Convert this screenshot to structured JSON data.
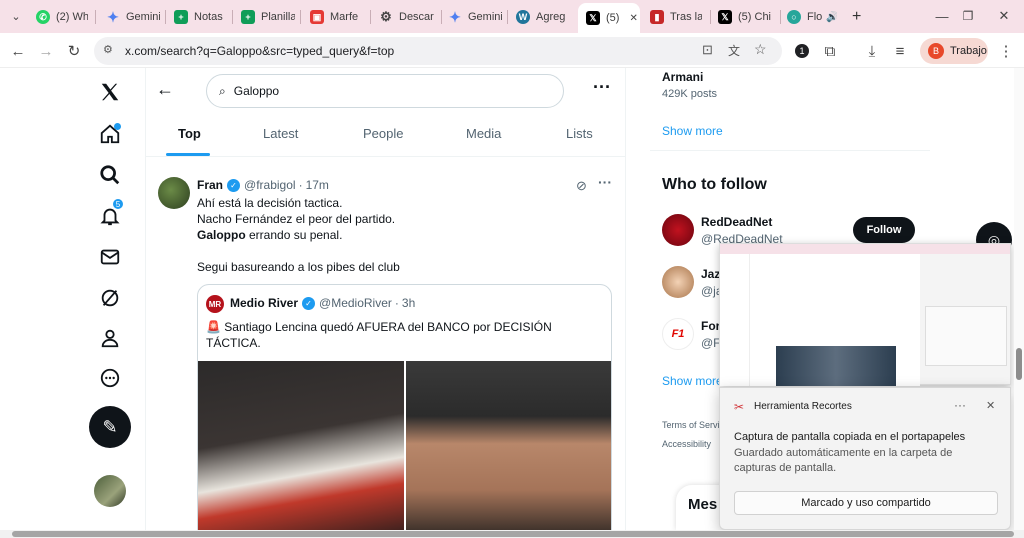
{
  "browser": {
    "tabs": [
      {
        "label": "(2) Wh",
        "fav": "whatsapp-icon",
        "color": "#25d366"
      },
      {
        "label": "Gemini",
        "fav": "gemini-icon",
        "color": "#4f7ff0"
      },
      {
        "label": "Notas",
        "fav": "sheets-icon",
        "color": "#0f9d58"
      },
      {
        "label": "Planilla",
        "fav": "sheets-icon",
        "color": "#0f9d58"
      },
      {
        "label": "Marfe",
        "fav": "gift-icon",
        "color": "#e53935"
      },
      {
        "label": "Descar",
        "fav": "openai-icon",
        "color": "#444444"
      },
      {
        "label": "Gemini",
        "fav": "gemini-icon",
        "color": "#4f7ff0"
      },
      {
        "label": "Agreg",
        "fav": "wordpress-icon",
        "color": "#21759b"
      },
      {
        "label": "(5)",
        "fav": "x-icon",
        "color": "#000000"
      },
      {
        "label": "Tras la",
        "fav": "flag-icon",
        "color": "#c62828"
      },
      {
        "label": "(5) Chi",
        "fav": "x-icon",
        "color": "#000000"
      },
      {
        "label": "Flo",
        "fav": "flo-icon",
        "color": "#26a69a"
      }
    ],
    "new_tab": "+",
    "url": "x.com/search?q=Galoppo&src=typed_query&f=top",
    "profile_label": "Trabajo",
    "profile_initial": "B",
    "extension_badge": "1"
  },
  "nav": {
    "notifications_count": "5"
  },
  "search": {
    "value": "Galoppo",
    "tabs": [
      "Top",
      "Latest",
      "People",
      "Media",
      "Lists"
    ],
    "selected_tab": "Top"
  },
  "tweet": {
    "name": "Fran",
    "handle": "@frabigol",
    "time": "17m",
    "line1": "Ahí está la decisión tactica.",
    "line2": "Nacho Fernández el peor del partido.",
    "line3_bold": "Galoppo",
    "line3_rest": " errando su penal.",
    "line4": "Segui basureando a los pibes del club",
    "quote": {
      "name": "Medio River",
      "handle": "@MedioRiver",
      "time": "3h",
      "text": "🚨 Santiago Lencina quedó AFUERA del BANCO por DECISIÓN TÁCTICA."
    }
  },
  "right": {
    "trend_name": "Armani",
    "trend_posts": "429K posts",
    "show_more_1": "Show more",
    "wtf_title": "Who to follow",
    "wtf": [
      {
        "name": "RedDeadNet",
        "handle": "@RedDeadNet"
      },
      {
        "name": "Jaz",
        "handle": "@ja"
      },
      {
        "name": "For",
        "handle": "@F"
      }
    ],
    "follow_label": "Follow",
    "show_more_2": "Show more",
    "footer_1": "Terms of Servic",
    "footer_2": "Accessibility",
    "messages_label": "Mes"
  },
  "snip": {
    "app": "Herramienta Recortes",
    "heading": "Captura de pantalla copiada en el portapapeles",
    "body": "Guardado automáticamente en la carpeta de capturas de pantalla.",
    "button": "Marcado y uso compartido",
    "more": "···",
    "close": "✕"
  },
  "colors": {
    "accent": "#1d9bf0",
    "tab_strip": "#f6e1e8"
  }
}
